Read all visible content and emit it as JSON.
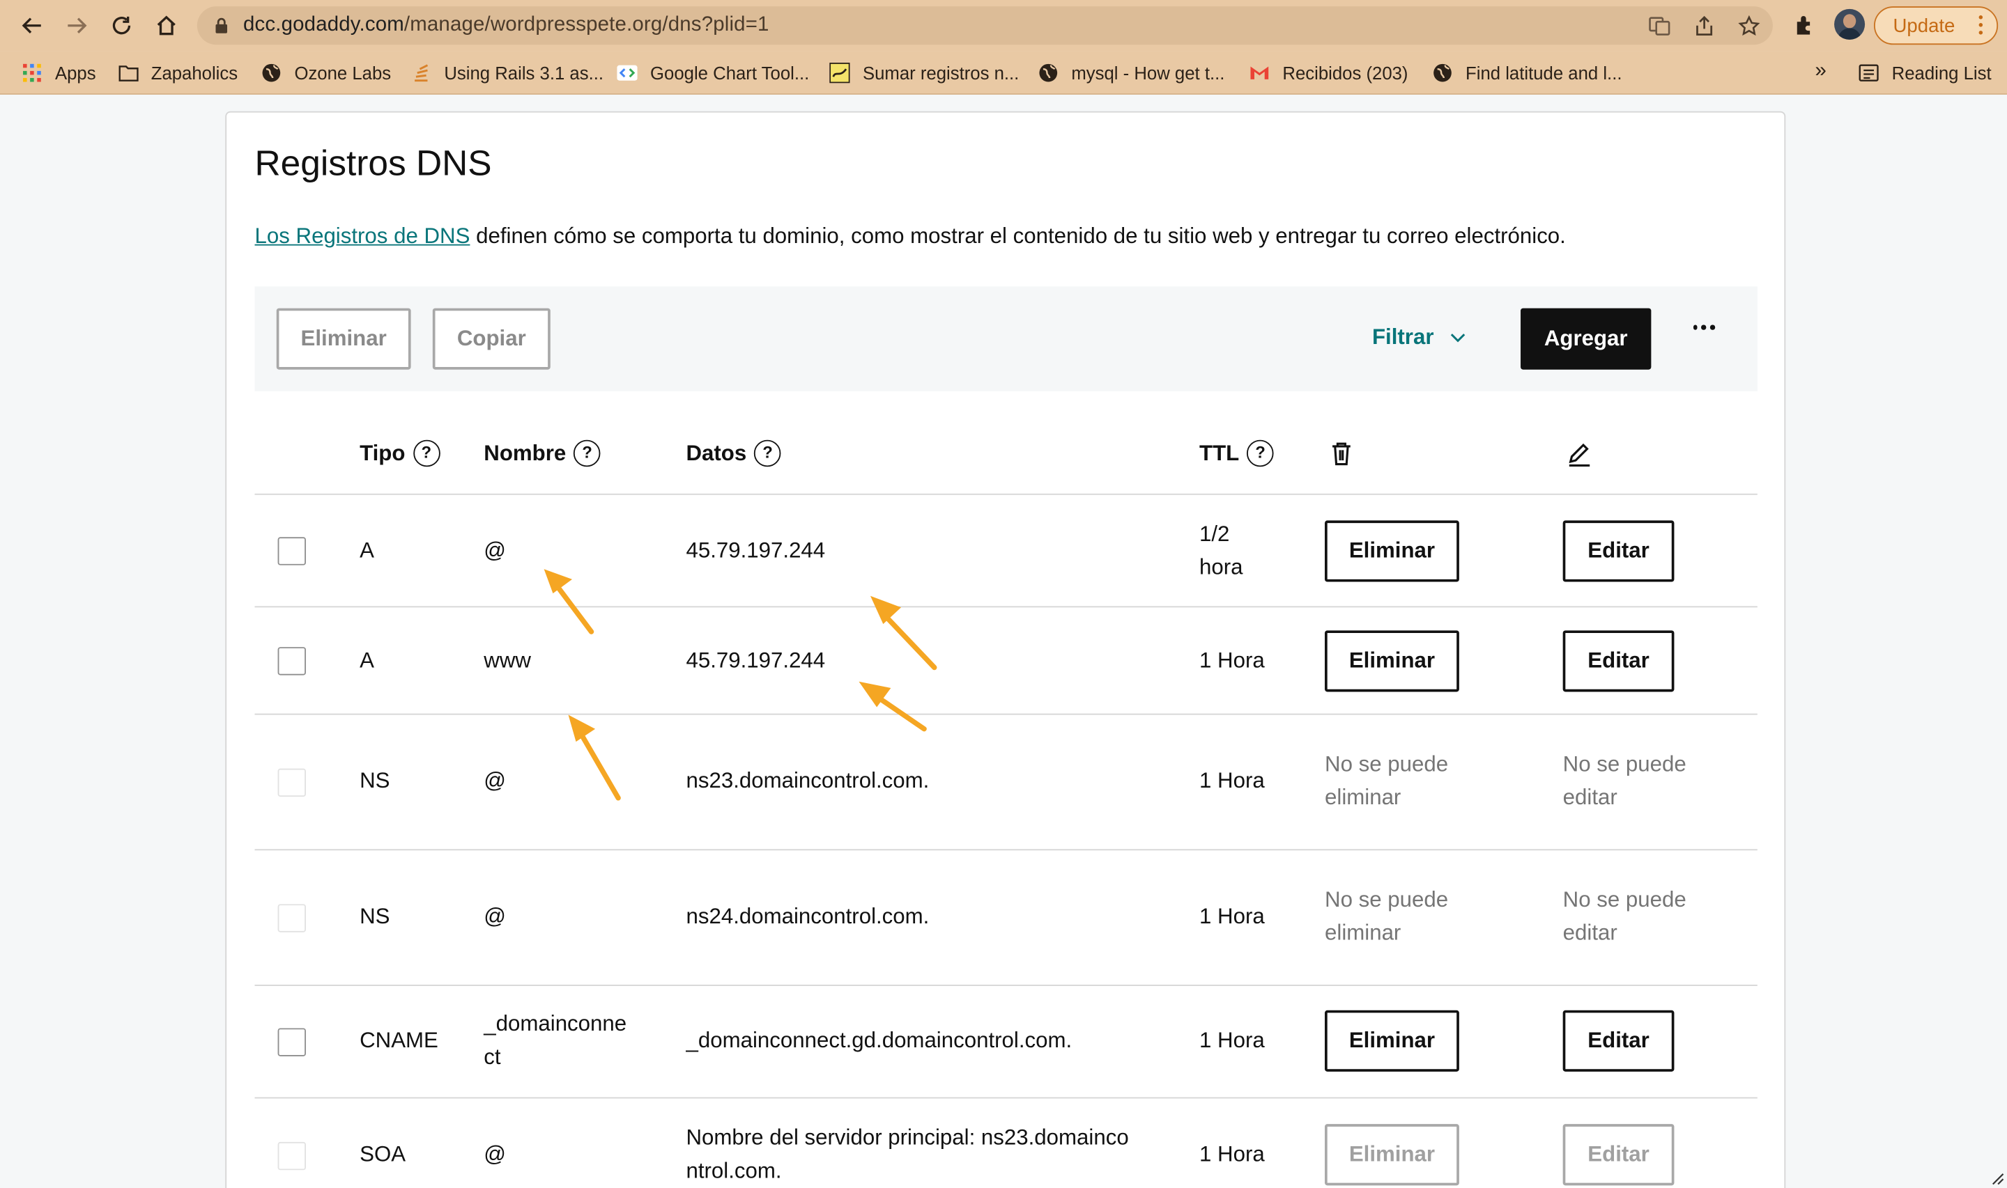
{
  "browser": {
    "url_host": "dcc.godaddy.com",
    "url_path": "/manage/wordpresspete.org/dns?plid=1",
    "update_label": "Update",
    "bookmarks": [
      {
        "label": "Apps",
        "icon": "apps-grid-icon"
      },
      {
        "label": "Zapaholics",
        "icon": "folder-icon"
      },
      {
        "label": "Ozone Labs",
        "icon": "globe-icon"
      },
      {
        "label": "Using Rails 3.1 as...",
        "icon": "stack-icon"
      },
      {
        "label": "Google Chart Tool...",
        "icon": "code-icon"
      },
      {
        "label": "Sumar registros n...",
        "icon": "chart-icon"
      },
      {
        "label": "mysql - How get t...",
        "icon": "globe-icon"
      },
      {
        "label": "Recibidos (203)",
        "icon": "gmail-icon"
      },
      {
        "label": "Find latitude and l...",
        "icon": "globe-icon"
      }
    ],
    "overflow_label": "»",
    "reading_list_label": "Reading List"
  },
  "page": {
    "title": "Registros DNS",
    "description_link": "Los Registros de DNS",
    "description_rest": " definen cómo se comporta tu dominio, como mostrar el contenido de tu sitio web y entregar tu correo electrónico.",
    "actions": {
      "delete_label": "Eliminar",
      "copy_label": "Copiar",
      "filter_label": "Filtrar",
      "add_label": "Agregar"
    },
    "table": {
      "headers": {
        "type": "Tipo",
        "name": "Nombre",
        "data": "Datos",
        "ttl": "TTL",
        "help": "?"
      },
      "delete_label": "Eliminar",
      "edit_label": "Editar",
      "cannot_delete_line1": "No se puede",
      "cannot_delete_line2": "eliminar",
      "cannot_edit_line1": "No se puede",
      "cannot_edit_line2": "editar",
      "rows": [
        {
          "type": "A",
          "name": "@",
          "data": "45.79.197.244",
          "ttl_line1": "1/2",
          "ttl_line2": "hora"
        },
        {
          "type": "A",
          "name": "www",
          "data": "45.79.197.244",
          "ttl": "1 Hora"
        },
        {
          "type": "NS",
          "name": "@",
          "data": "ns23.domaincontrol.com.",
          "ttl": "1 Hora"
        },
        {
          "type": "NS",
          "name": "@",
          "data": "ns24.domaincontrol.com.",
          "ttl": "1 Hora"
        },
        {
          "type": "CNAME",
          "name_line1": "_domainconne",
          "name_line2": "ct",
          "data": "_domainconnect.gd.domaincontrol.com.",
          "ttl": "1 Hora"
        },
        {
          "type": "SOA",
          "name": "@",
          "data_line1": "Nombre del servidor principal: ns23.domainco",
          "data_line2": "ntrol.com.",
          "ttl": "1 Hora"
        }
      ]
    }
  },
  "colors": {
    "accent_teal": "#09757a",
    "annotation_arrow": "#f5a623",
    "chrome": "#e9c9a4"
  }
}
